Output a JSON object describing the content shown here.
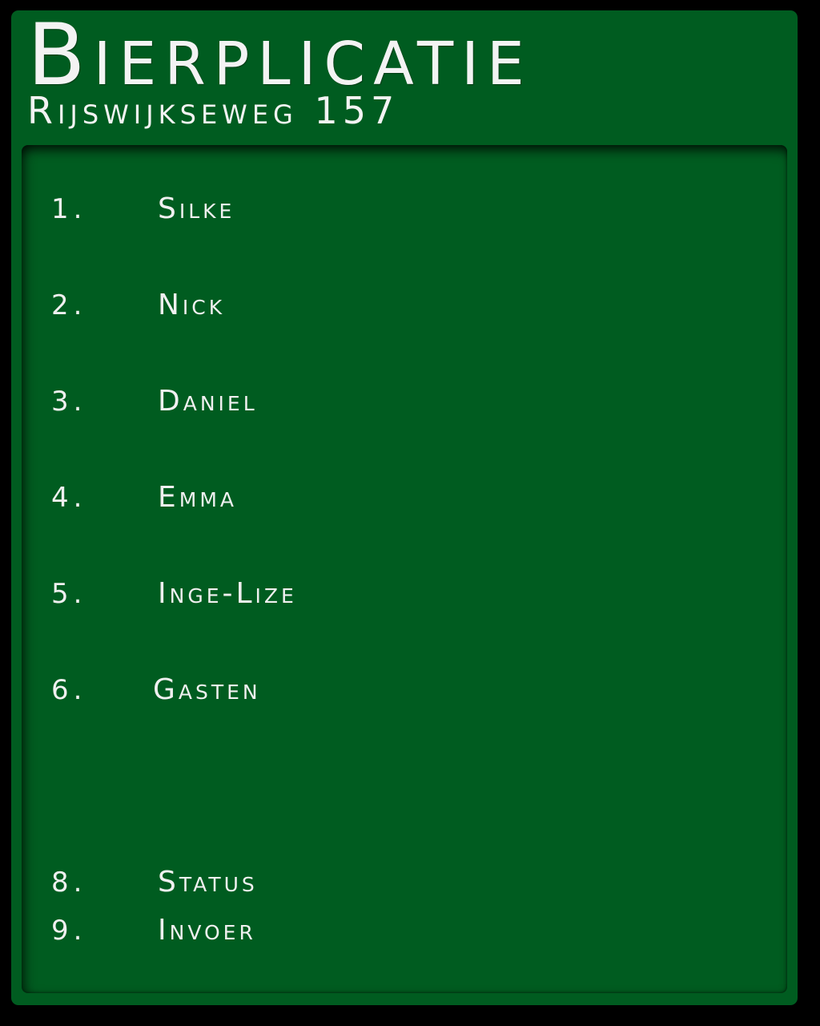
{
  "header": {
    "title": "Bierplicatie",
    "address": "Rijswijkseweg 157"
  },
  "menu": {
    "items": [
      {
        "number": "1.",
        "label": "Silke"
      },
      {
        "number": "2.",
        "label": "Nick"
      },
      {
        "number": "3.",
        "label": "Daniel"
      },
      {
        "number": "4.",
        "label": "Emma"
      },
      {
        "number": "5.",
        "label": "Inge-Lize"
      },
      {
        "number": "6.",
        "label": "Gasten"
      },
      {
        "number": "8.",
        "label": "Status"
      },
      {
        "number": "9.",
        "label": "Invoer"
      }
    ]
  },
  "colors": {
    "background": "#000000",
    "panel_green": "#005c20",
    "text": "#f0f0f0"
  }
}
